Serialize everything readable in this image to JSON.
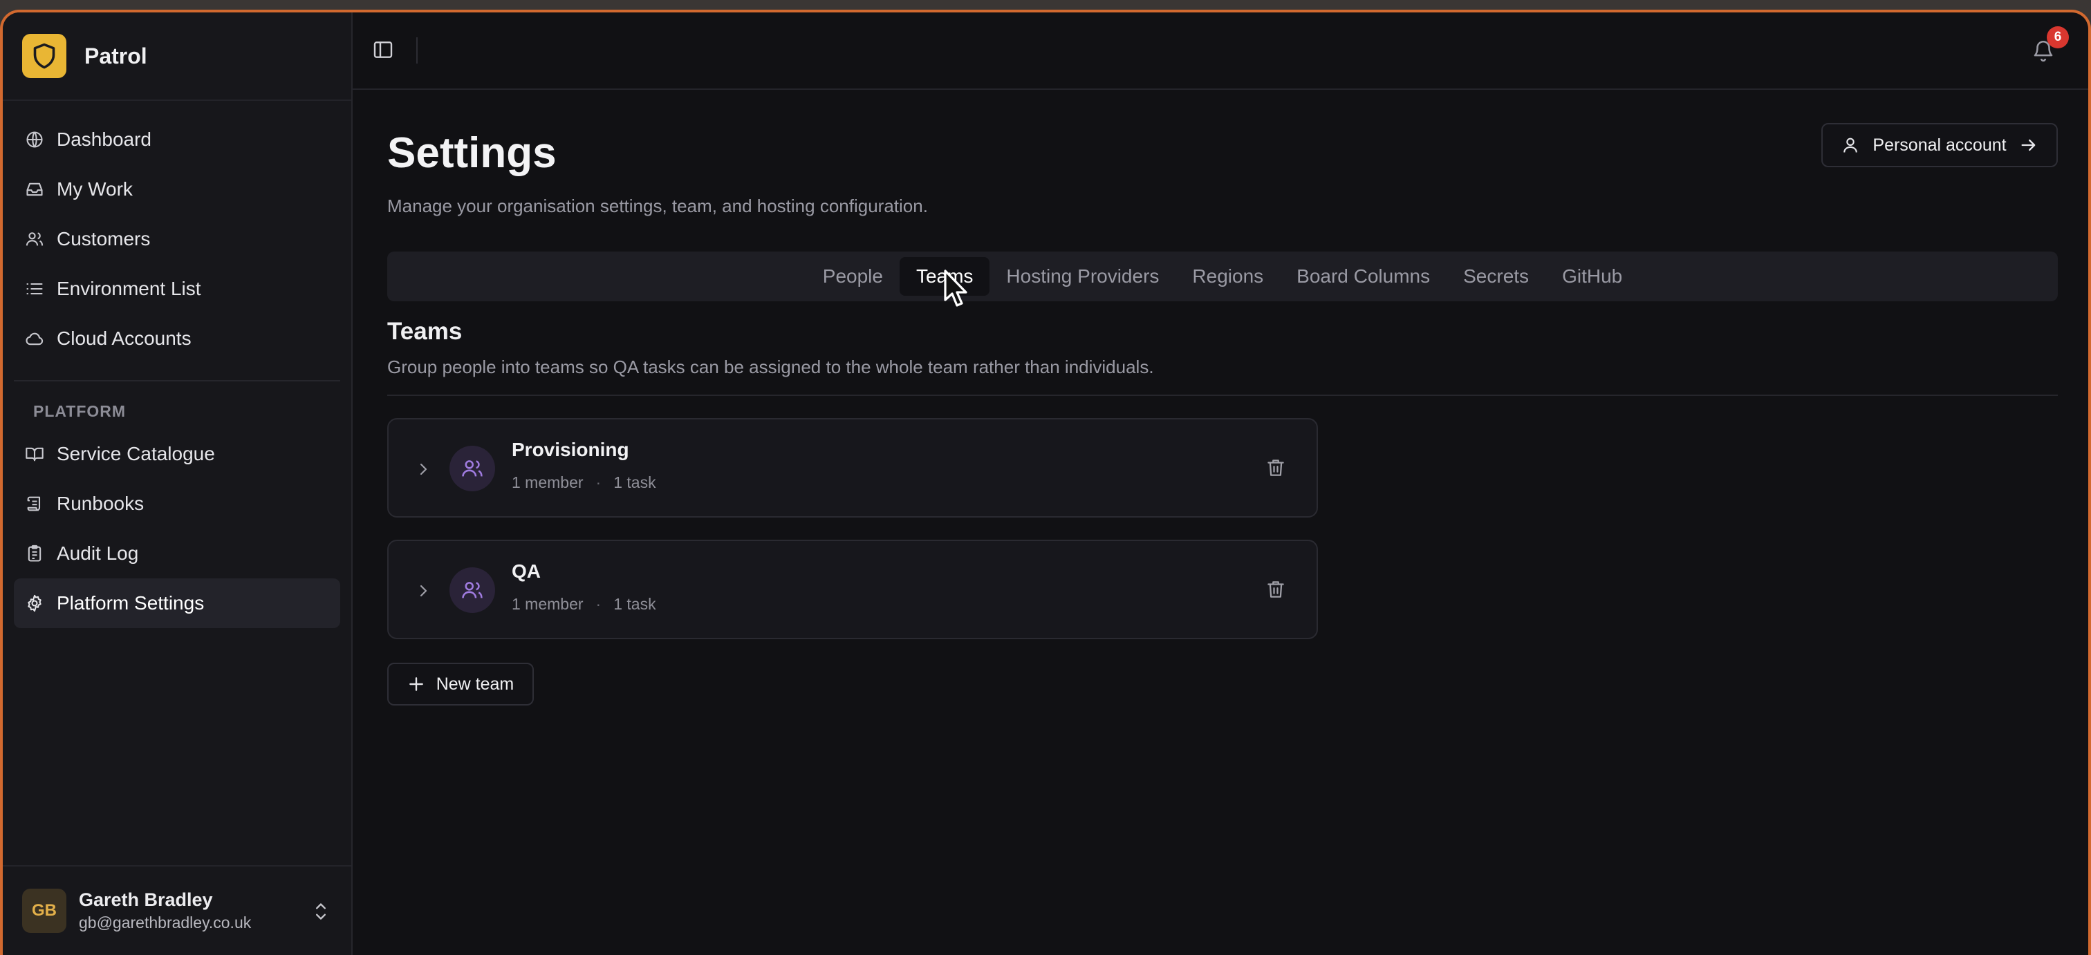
{
  "app": {
    "name": "Patrol",
    "notification_count": "6"
  },
  "sidebar": {
    "items": [
      {
        "label": "Dashboard",
        "icon": "globe-icon"
      },
      {
        "label": "My Work",
        "icon": "inbox-icon"
      },
      {
        "label": "Customers",
        "icon": "users-icon"
      },
      {
        "label": "Environment List",
        "icon": "list-icon"
      },
      {
        "label": "Cloud Accounts",
        "icon": "cloud-icon"
      }
    ],
    "platform_label": "PLATFORM",
    "platform_items": [
      {
        "label": "Service Catalogue",
        "icon": "book-icon"
      },
      {
        "label": "Runbooks",
        "icon": "scroll-icon"
      },
      {
        "label": "Audit Log",
        "icon": "clipboard-icon"
      },
      {
        "label": "Platform Settings",
        "icon": "gear-icon",
        "active": true
      }
    ],
    "user": {
      "initials": "GB",
      "name": "Gareth Bradley",
      "email": "gb@garethbradley.co.uk"
    }
  },
  "header": {
    "title": "Settings",
    "subtitle": "Manage your organisation settings, team, and hosting configuration.",
    "personal_account_label": "Personal account"
  },
  "tabs": [
    {
      "label": "People"
    },
    {
      "label": "Teams",
      "active": true
    },
    {
      "label": "Hosting Providers"
    },
    {
      "label": "Regions"
    },
    {
      "label": "Board Columns"
    },
    {
      "label": "Secrets"
    },
    {
      "label": "GitHub"
    }
  ],
  "teams_section": {
    "title": "Teams",
    "subtitle": "Group people into teams so QA tasks can be assigned to the whole team rather than individuals.",
    "teams": [
      {
        "name": "Provisioning",
        "members": "1 member",
        "tasks": "1 task"
      },
      {
        "name": "QA",
        "members": "1 member",
        "tasks": "1 task"
      }
    ],
    "new_team_label": "New team"
  },
  "colors": {
    "accent": "#e9b634",
    "team_icon": "#a07ce0",
    "badge": "#d9372f",
    "frame_glow": "#d2692f"
  }
}
